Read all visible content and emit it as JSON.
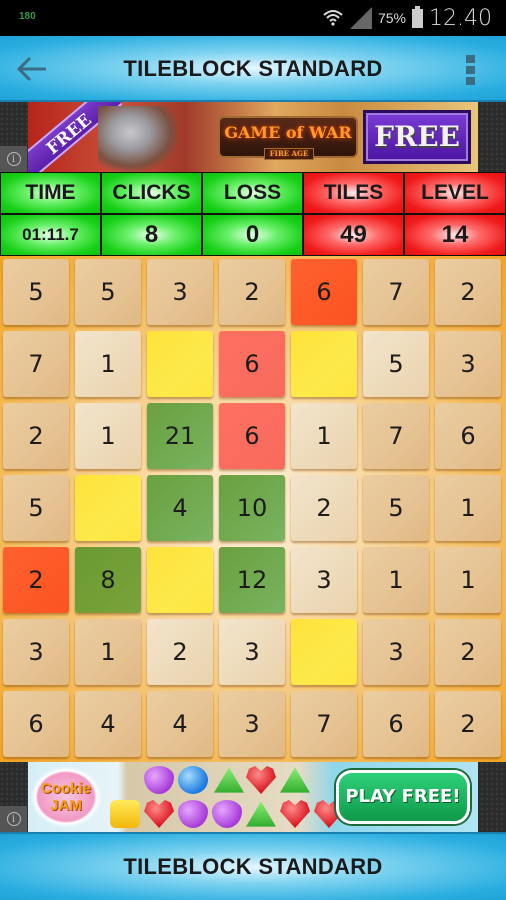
{
  "status_bar": {
    "left_text": "180",
    "battery_percent": "75%",
    "time": "12.40",
    "icons": [
      "wifi-icon",
      "cell-signal-icon",
      "battery-icon"
    ]
  },
  "app_bar": {
    "title": "TILEBLOCK STANDARD",
    "back_icon": "arrow-left-icon",
    "menu_icon": "more-vert-icon"
  },
  "ad_top": {
    "ribbon": "FREE",
    "logo": "GAME of WAR",
    "logo_sub": "FIRE AGE",
    "cta": "FREE",
    "info_icon": "i"
  },
  "stats": {
    "labels": [
      "TIME",
      "CLICKS",
      "LOSS",
      "TILES",
      "LEVEL"
    ],
    "values": [
      "01:11.7",
      "8",
      "0",
      "49",
      "14"
    ],
    "colors": [
      "green",
      "green",
      "green",
      "red",
      "red"
    ]
  },
  "board": {
    "rows": 7,
    "cols": 7,
    "tiles": [
      [
        {
          "v": "5",
          "c": "plain"
        },
        {
          "v": "5",
          "c": "plain"
        },
        {
          "v": "3",
          "c": "plain"
        },
        {
          "v": "2",
          "c": "plain"
        },
        {
          "v": "6",
          "c": "orange"
        },
        {
          "v": "7",
          "c": "plain"
        },
        {
          "v": "2",
          "c": "plain"
        }
      ],
      [
        {
          "v": "7",
          "c": "plain"
        },
        {
          "v": "1",
          "c": "light"
        },
        {
          "v": "",
          "c": "yellow"
        },
        {
          "v": "6",
          "c": "salmon"
        },
        {
          "v": "",
          "c": "yellow"
        },
        {
          "v": "5",
          "c": "light"
        },
        {
          "v": "3",
          "c": "plain"
        }
      ],
      [
        {
          "v": "2",
          "c": "plain"
        },
        {
          "v": "1",
          "c": "light"
        },
        {
          "v": "21",
          "c": "green"
        },
        {
          "v": "6",
          "c": "salmon"
        },
        {
          "v": "1",
          "c": "light"
        },
        {
          "v": "7",
          "c": "plain"
        },
        {
          "v": "6",
          "c": "plain"
        }
      ],
      [
        {
          "v": "5",
          "c": "plain"
        },
        {
          "v": "",
          "c": "yellow"
        },
        {
          "v": "4",
          "c": "green"
        },
        {
          "v": "10",
          "c": "green"
        },
        {
          "v": "2",
          "c": "light"
        },
        {
          "v": "5",
          "c": "plain"
        },
        {
          "v": "1",
          "c": "plain"
        }
      ],
      [
        {
          "v": "2",
          "c": "orange"
        },
        {
          "v": "8",
          "c": "dkgreen"
        },
        {
          "v": "",
          "c": "yellow"
        },
        {
          "v": "12",
          "c": "green"
        },
        {
          "v": "3",
          "c": "light"
        },
        {
          "v": "1",
          "c": "plain"
        },
        {
          "v": "1",
          "c": "plain"
        }
      ],
      [
        {
          "v": "3",
          "c": "plain"
        },
        {
          "v": "1",
          "c": "plain"
        },
        {
          "v": "2",
          "c": "light"
        },
        {
          "v": "3",
          "c": "light"
        },
        {
          "v": "",
          "c": "yellow"
        },
        {
          "v": "3",
          "c": "plain"
        },
        {
          "v": "2",
          "c": "plain"
        }
      ],
      [
        {
          "v": "6",
          "c": "plain"
        },
        {
          "v": "4",
          "c": "plain"
        },
        {
          "v": "4",
          "c": "plain"
        },
        {
          "v": "3",
          "c": "plain"
        },
        {
          "v": "7",
          "c": "plain"
        },
        {
          "v": "6",
          "c": "plain"
        },
        {
          "v": "2",
          "c": "plain"
        }
      ]
    ]
  },
  "ad_bottom": {
    "logo": "Cookie JAM",
    "cta": "PLAY FREE!",
    "info_icon": "i"
  },
  "bottom_bar": {
    "title": "TILEBLOCK STANDARD"
  },
  "colors": {
    "appbar_blue": "#2aaee0",
    "stat_green": "#18d018",
    "stat_red": "#f01a1a",
    "board_orange": "#f2a524"
  }
}
